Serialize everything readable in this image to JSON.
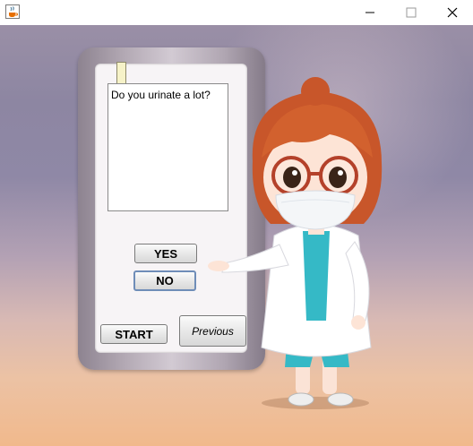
{
  "window": {
    "app_icon": "java-cup-icon",
    "controls": [
      "minimize-icon",
      "maximize-icon",
      "close-icon"
    ]
  },
  "device": {
    "question": "Do you urinate a lot?"
  },
  "buttons": {
    "yes": "YES",
    "no": "NO",
    "start": "START",
    "previous": "Previous"
  },
  "colors": {
    "focus_border": "#6f8db8",
    "coat": "#ffffff",
    "scrubs": "#35b9c6",
    "hair": "#c8562a"
  }
}
